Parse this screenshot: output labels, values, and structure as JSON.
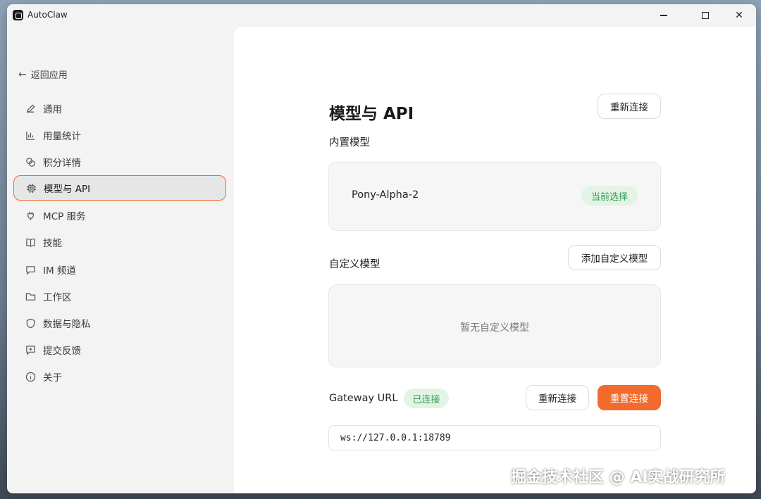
{
  "window": {
    "title": "AutoClaw",
    "controls": {
      "minimize": "minimize-icon",
      "maximize": "maximize-icon",
      "close": "close-icon"
    }
  },
  "sidebar": {
    "back_label": "返回应用",
    "items": [
      {
        "label": "通用",
        "icon": "pencil-icon",
        "active": false
      },
      {
        "label": "用量统计",
        "icon": "bar-chart-icon",
        "active": false
      },
      {
        "label": "积分详情",
        "icon": "coins-icon",
        "active": false
      },
      {
        "label": "模型与 API",
        "icon": "chip-icon",
        "active": true
      },
      {
        "label": "MCP 服务",
        "icon": "plug-icon",
        "active": false
      },
      {
        "label": "技能",
        "icon": "book-icon",
        "active": false
      },
      {
        "label": "IM 频道",
        "icon": "message-icon",
        "active": false
      },
      {
        "label": "工作区",
        "icon": "folder-icon",
        "active": false
      },
      {
        "label": "数据与隐私",
        "icon": "shield-icon",
        "active": false
      },
      {
        "label": "提交反馈",
        "icon": "feedback-icon",
        "active": false
      },
      {
        "label": "关于",
        "icon": "info-icon",
        "active": false
      }
    ]
  },
  "main": {
    "title": "模型与 API",
    "reconnect_top_label": "重新连接",
    "builtin": {
      "label": "内置模型",
      "model_name": "Pony-Alpha-2",
      "badge": "当前选择"
    },
    "custom": {
      "label": "自定义模型",
      "add_label": "添加自定义模型",
      "empty_text": "暂无自定义模型"
    },
    "gateway": {
      "label": "Gateway URL",
      "status": "已连接",
      "reconnect_label": "重新连接",
      "reset_label": "重置连接",
      "url": "ws://127.0.0.1:18789"
    }
  },
  "colors": {
    "accent": "#f26b2d",
    "success_bg": "#e3f3e6",
    "success_text": "#2f9a4d"
  },
  "watermark": "掘金技术社区 @ AI实战研究所"
}
